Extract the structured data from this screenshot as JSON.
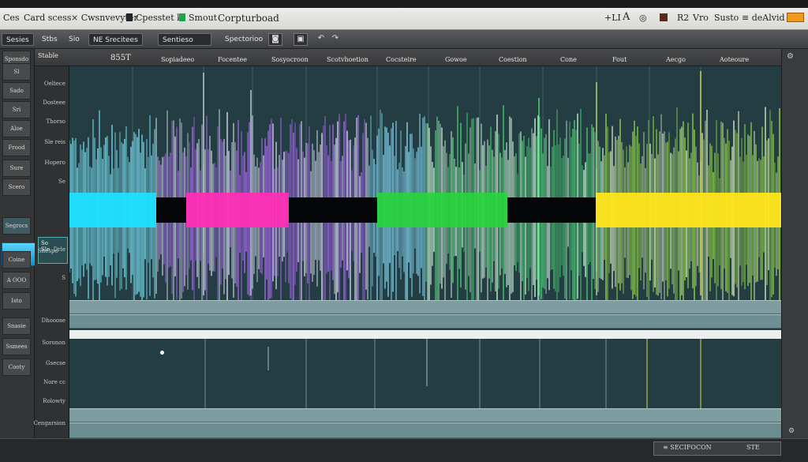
{
  "titlebar": {
    "items": [
      "Ces",
      "Card scess",
      "× Cwsnvevyter",
      "Cpesstet k",
      "Smout",
      "Corpturboad"
    ],
    "right_items": [
      "+LI",
      "A",
      "◎",
      "R2",
      "Vro",
      "Susto",
      "≡ deAlvid"
    ]
  },
  "toolbar": {
    "btn1": "Sesies",
    "btn2": "Stbs",
    "btn3": "Sio",
    "btn4": "NE Srecitees",
    "btn5": "Sentieso",
    "btn6": "Spectorioo"
  },
  "columns": [
    "Stable",
    "855T",
    "Sopiadeeo",
    "Focentee",
    "Sosyocroon",
    "Scotvhoetion",
    "Cocsteire",
    "Gowoe",
    "Coestion",
    "Cone",
    "Fout",
    "Aecgo",
    "Aoteoure"
  ],
  "sidebar": {
    "items": [
      "Sponsdo",
      "Sl",
      "Sado",
      "Sri",
      "Aloe",
      "Frood",
      "Sure",
      "Scero",
      "Segrocs",
      "Coine",
      "A OOO",
      "Isto",
      "Snasie",
      "Ssmees",
      "Cooty"
    ]
  },
  "labels": [
    "Oeltece",
    "Dosteee",
    "Thorso",
    "Sle reis",
    "Hopero",
    "Se",
    "Drle",
    "Snespo",
    "S",
    "Dhooose",
    "Soronon",
    "Gsecse",
    "Nore cc",
    "Rolowty",
    "Cengarsion"
  ],
  "selected_label": {
    "line1": "So",
    "line2": "Sle"
  },
  "status": {
    "left": "",
    "right": "≡ SECIFOCON",
    "right2": "STE"
  },
  "colors": {
    "cyan": "#1ee0ff",
    "magenta": "#ff2fb5",
    "green": "#27d53b",
    "yellow": "#ffe51a",
    "accent_orange": "#f09a1c"
  }
}
